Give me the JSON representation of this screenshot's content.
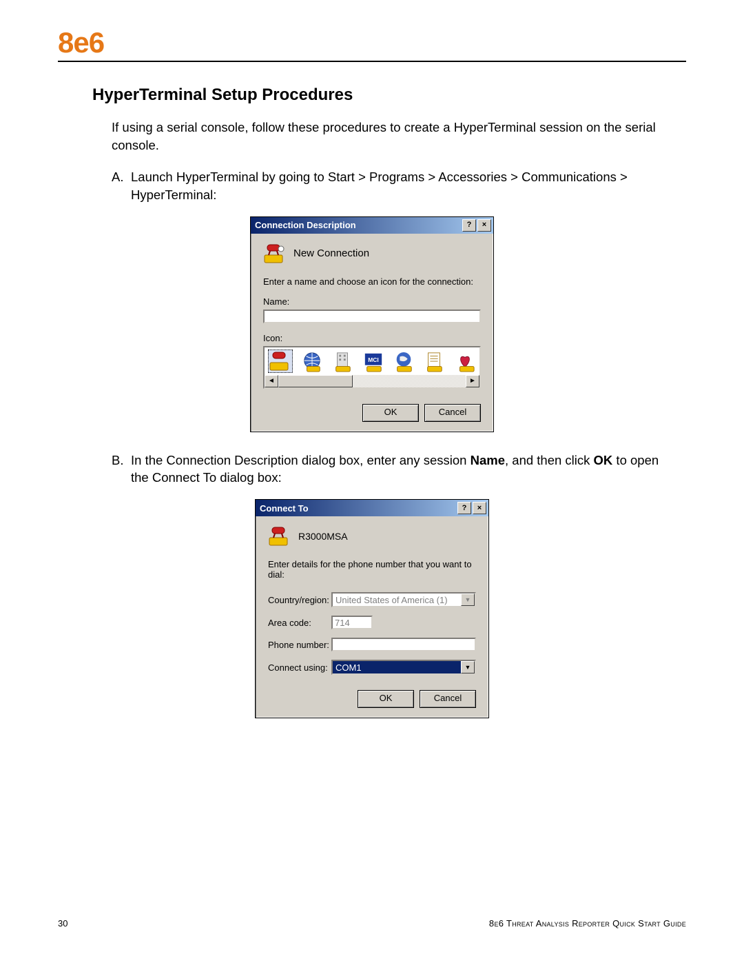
{
  "logo": "8e6",
  "section_title": "HyperTerminal Setup Procedures",
  "intro": "If using a serial console, follow these procedures to create a HyperTerminal session on the serial console.",
  "step_a_marker": "A.",
  "step_a": "Launch HyperTerminal by going to Start > Programs > Accessories > Communications > HyperTerminal:",
  "step_b_marker": "B.",
  "step_b_1": "In the Connection Description dialog box, enter any session ",
  "step_b_name": "Name",
  "step_b_2": ", and then click ",
  "step_b_ok": "OK",
  "step_b_3": " to open the Connect To dialog box:",
  "dlg1": {
    "title": "Connection Description",
    "help": "?",
    "close": "×",
    "header": "New Connection",
    "instruction": "Enter a name and choose an icon for the connection:",
    "name_label": "Name:",
    "name_value": "",
    "icon_label": "Icon:",
    "scroll_left": "◄",
    "scroll_right": "►",
    "ok": "OK",
    "cancel": "Cancel"
  },
  "dlg2": {
    "title": "Connect To",
    "help": "?",
    "close": "×",
    "header": "R3000MSA",
    "instruction": "Enter details for the phone number that you want to dial:",
    "country_label": "Country/region:",
    "country_value": "United States of America (1)",
    "area_label": "Area code:",
    "area_value": "714",
    "phone_label": "Phone number:",
    "phone_value": "",
    "connect_label": "Connect using:",
    "connect_value": "COM1",
    "arrow": "▼",
    "ok": "OK",
    "cancel": "Cancel"
  },
  "footer": {
    "page": "30",
    "guide": "8e6 Threat Analysis Reporter Quick Start Guide"
  }
}
